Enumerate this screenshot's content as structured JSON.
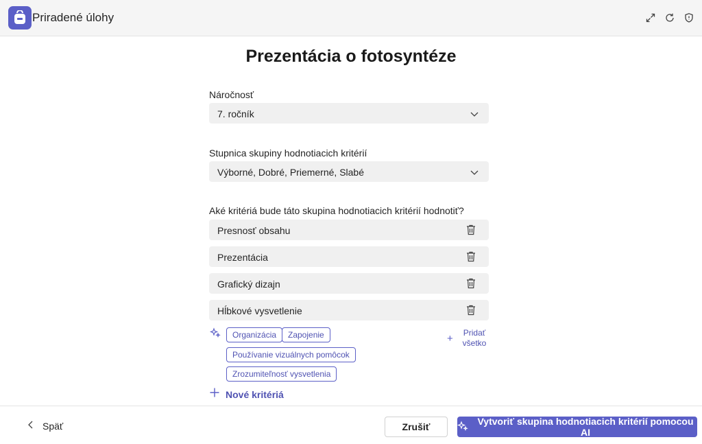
{
  "app": {
    "title": "Priradené úlohy",
    "icon": "backpack-icon",
    "actions": [
      "expand-icon",
      "refresh-icon",
      "shield-icon"
    ]
  },
  "page": {
    "title": "Prezentácia o fotosyntéze"
  },
  "difficulty": {
    "label": "Náročnosť",
    "value": "7. ročník"
  },
  "scale": {
    "label": "Stupnica skupiny hodnotiacich kritérií",
    "value": "Výborné, Dobré, Priemerné, Slabé"
  },
  "criteria": {
    "label": "Aké kritériá bude táto skupina hodnotiacich kritérií hodnotiť?",
    "items": [
      "Presnosť obsahu",
      "Prezentácia",
      "Grafický dizajn",
      "Hĺbkové vysvetlenie"
    ],
    "suggestions": [
      "Organizácia",
      "Zapojenie",
      "Používanie vizuálnych pomôcok",
      "Zrozumiteľnosť vysvetlenia"
    ],
    "add_all_label": "Pridať všetko",
    "new_label": "Nové kritériá"
  },
  "footer": {
    "back_label": "Späť",
    "cancel_label": "Zrušiť",
    "create_label": "Vytvoriť skupina hodnotiacich kritérií pomocou AI"
  },
  "colors": {
    "accent": "#5b5fc7",
    "accent_text": "#4f52b2",
    "field_bg": "#f0f0f0",
    "topbar_bg": "#f5f5f5"
  }
}
